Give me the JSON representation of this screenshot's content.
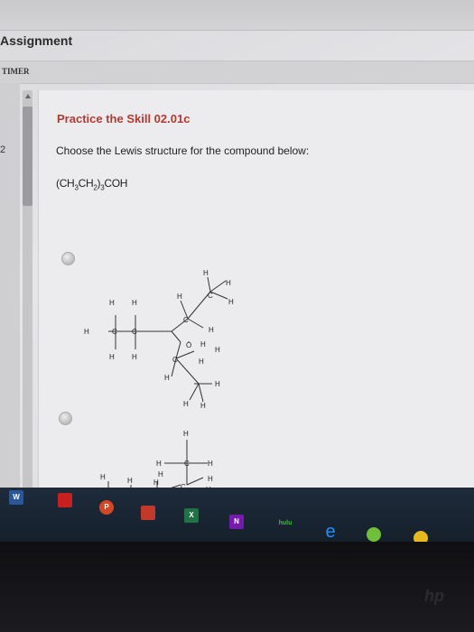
{
  "header": {
    "title": "Assignment"
  },
  "timer": {
    "label": "TIMER"
  },
  "gutter": {
    "question_number": "2"
  },
  "question": {
    "title": "Practice the Skill 02.01c",
    "prompt": "Choose the Lewis structure for the compound below:",
    "formula": "(CH3CH2)3COH"
  },
  "option_a": {
    "atoms": [
      "H",
      "H",
      "H",
      "C",
      "H",
      "C",
      "H",
      "H",
      "H",
      "H",
      "C",
      "H",
      "H",
      "Ö",
      "H",
      "C",
      "H",
      "H",
      "H",
      "C",
      "H",
      "H",
      "H"
    ]
  },
  "option_b": {
    "atoms": [
      "H",
      "H",
      "C",
      "H",
      "H",
      "H",
      "H",
      "H",
      "H",
      "H",
      "C",
      "H",
      "C",
      "H"
    ]
  },
  "taskbar": {
    "items": [
      {
        "name": "word-icon",
        "label": "W",
        "color": "#2b579a"
      },
      {
        "name": "acrobat-icon",
        "label": "",
        "color": "#c8201f"
      },
      {
        "name": "powerpoint-icon",
        "label": "P",
        "color": "#d24726"
      },
      {
        "name": "calculator-icon",
        "label": "",
        "color": "#c0392b"
      },
      {
        "name": "excel-icon",
        "label": "X",
        "color": "#217346"
      },
      {
        "name": "onenote-icon",
        "label": "N",
        "color": "#7719aa"
      },
      {
        "name": "hulu-icon",
        "label": "hulu",
        "color": "#3dbb3d"
      },
      {
        "name": "internet-explorer-icon",
        "label": "e",
        "color": "#1e90ff"
      },
      {
        "name": "quickbooks-icon",
        "label": "",
        "color": "#6fbf3b"
      },
      {
        "name": "chrome-icon",
        "label": "",
        "color": "#e6b91e"
      }
    ]
  }
}
